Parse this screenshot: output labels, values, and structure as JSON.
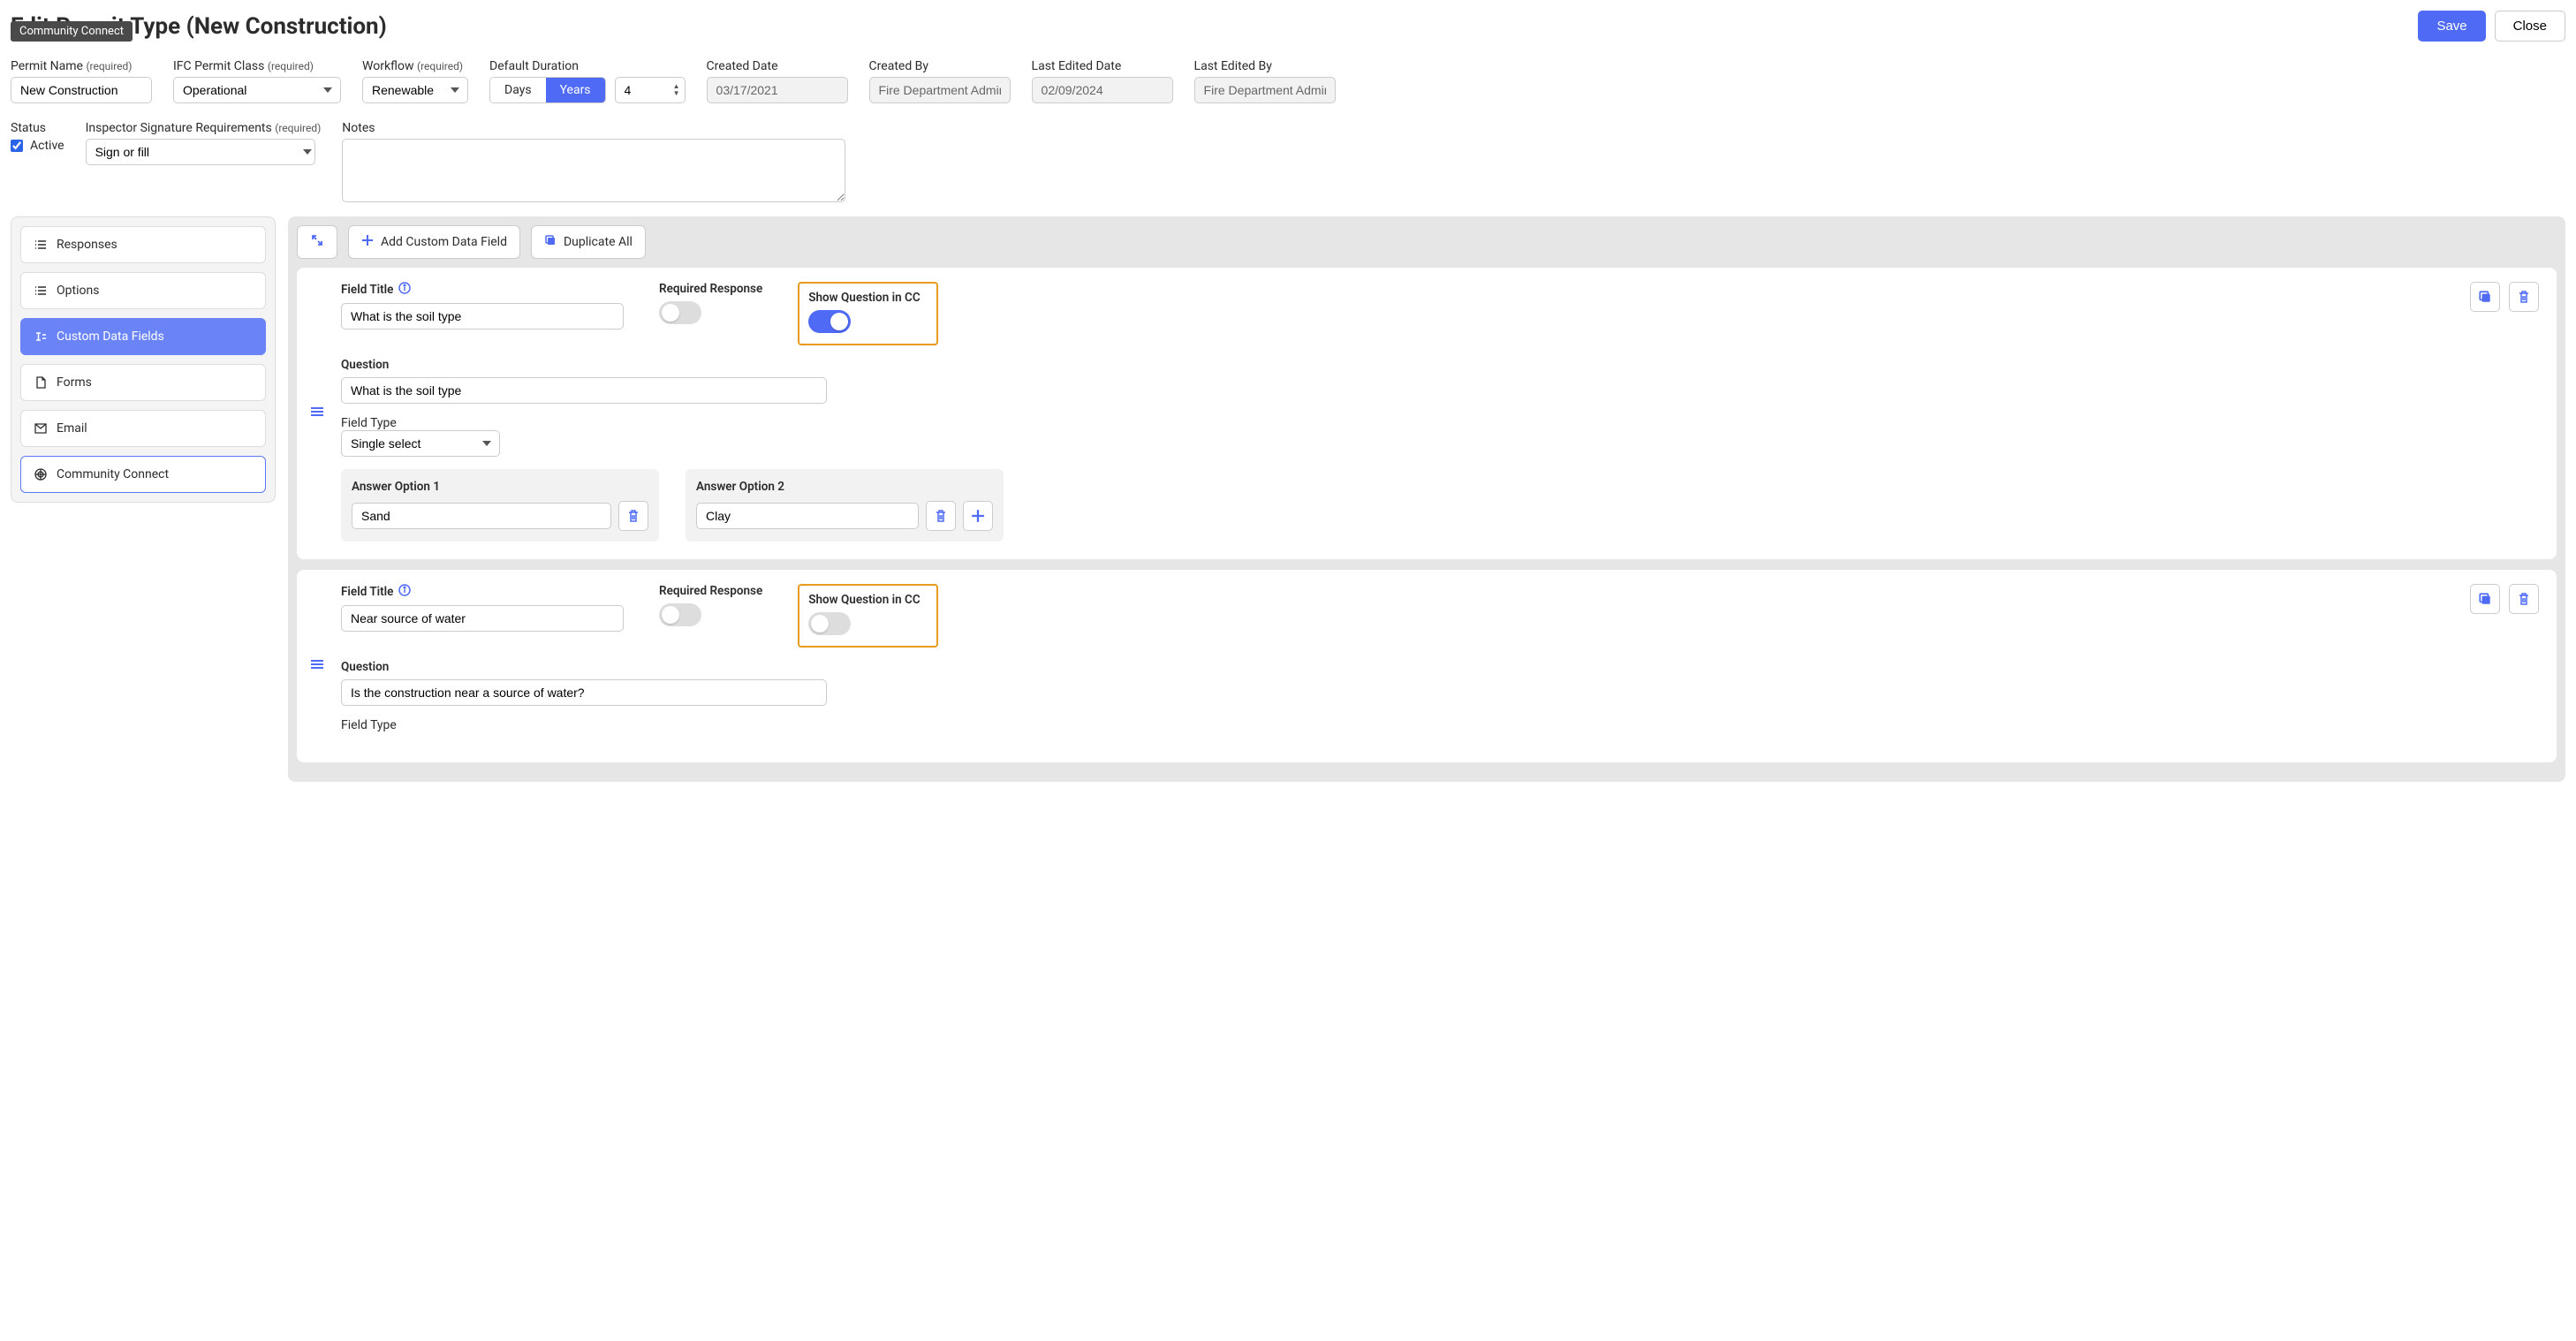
{
  "tooltip": "Community Connect",
  "page_title": "Edit Permit Type (New Construction)",
  "header_actions": {
    "save": "Save",
    "close": "Close"
  },
  "fields": {
    "permit_name": {
      "label": "Permit Name",
      "req": "(required)",
      "value": "New Construction"
    },
    "ifc_class": {
      "label": "IFC Permit Class",
      "req": "(required)",
      "value": "Operational"
    },
    "workflow": {
      "label": "Workflow",
      "req": "(required)",
      "value": "Renewable"
    },
    "default_duration": {
      "label": "Default Duration",
      "days": "Days",
      "years": "Years",
      "value": "4"
    },
    "created_date": {
      "label": "Created Date",
      "value": "03/17/2021"
    },
    "created_by": {
      "label": "Created By",
      "value": "Fire Department Admin -"
    },
    "last_edited_date": {
      "label": "Last Edited Date",
      "value": "02/09/2024"
    },
    "last_edited_by": {
      "label": "Last Edited By",
      "value": "Fire Department Admin -"
    },
    "status": {
      "label": "Status",
      "active_label": "Active"
    },
    "inspector_sig": {
      "label": "Inspector Signature Requirements",
      "req": "(required)",
      "value": "Sign or fill"
    },
    "notes": {
      "label": "Notes",
      "value": ""
    }
  },
  "sidebar": {
    "items": [
      {
        "label": "Responses",
        "icon": "list"
      },
      {
        "label": "Options",
        "icon": "list"
      },
      {
        "label": "Custom Data Fields",
        "icon": "text"
      },
      {
        "label": "Forms",
        "icon": "doc"
      },
      {
        "label": "Email",
        "icon": "mail"
      },
      {
        "label": "Community Connect",
        "icon": "cc"
      }
    ]
  },
  "toolbar": {
    "expand_icon": "expand",
    "add_field": "Add Custom Data Field",
    "duplicate_all": "Duplicate All"
  },
  "labels": {
    "field_title": "Field Title",
    "required_response": "Required Response",
    "show_in_cc": "Show Question in CC",
    "question": "Question",
    "field_type": "Field Type",
    "answer_option_prefix": "Answer Option "
  },
  "data_fields": [
    {
      "title": "What is the soil type",
      "required": false,
      "show_cc": true,
      "question": "What is the soil type",
      "field_type": "Single select",
      "options": [
        "Sand",
        "Clay"
      ]
    },
    {
      "title": "Near source of water",
      "required": false,
      "show_cc": false,
      "question": "Is the construction near a source of water?",
      "field_type": "",
      "options": []
    }
  ]
}
